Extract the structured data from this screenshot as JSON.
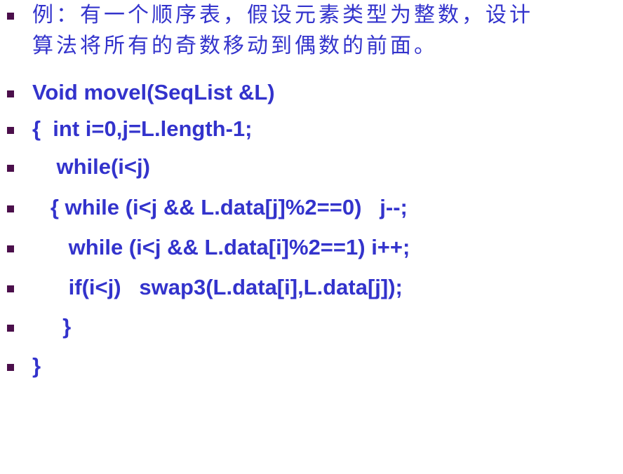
{
  "slide": {
    "intro_line1": "例：有一个顺序表，假设元素类型为整数，设计",
    "intro_line2": "算法将所有的奇数移动到偶数的前面。",
    "code_lines": [
      "Void movel(SeqList &L)",
      "{  int i=0,j=L.length-1;",
      "    while(i<j)",
      "   { while (i<j && L.data[j]%2==0)   j--;",
      "      while (i<j && L.data[i]%2==1) i++;",
      "      if(i<j)   swap3(L.data[i],L.data[j]);",
      "     }",
      "}"
    ]
  },
  "colors": {
    "text": "#3333cc",
    "bullet": "#4b0f4b",
    "background": "#ffffff"
  }
}
